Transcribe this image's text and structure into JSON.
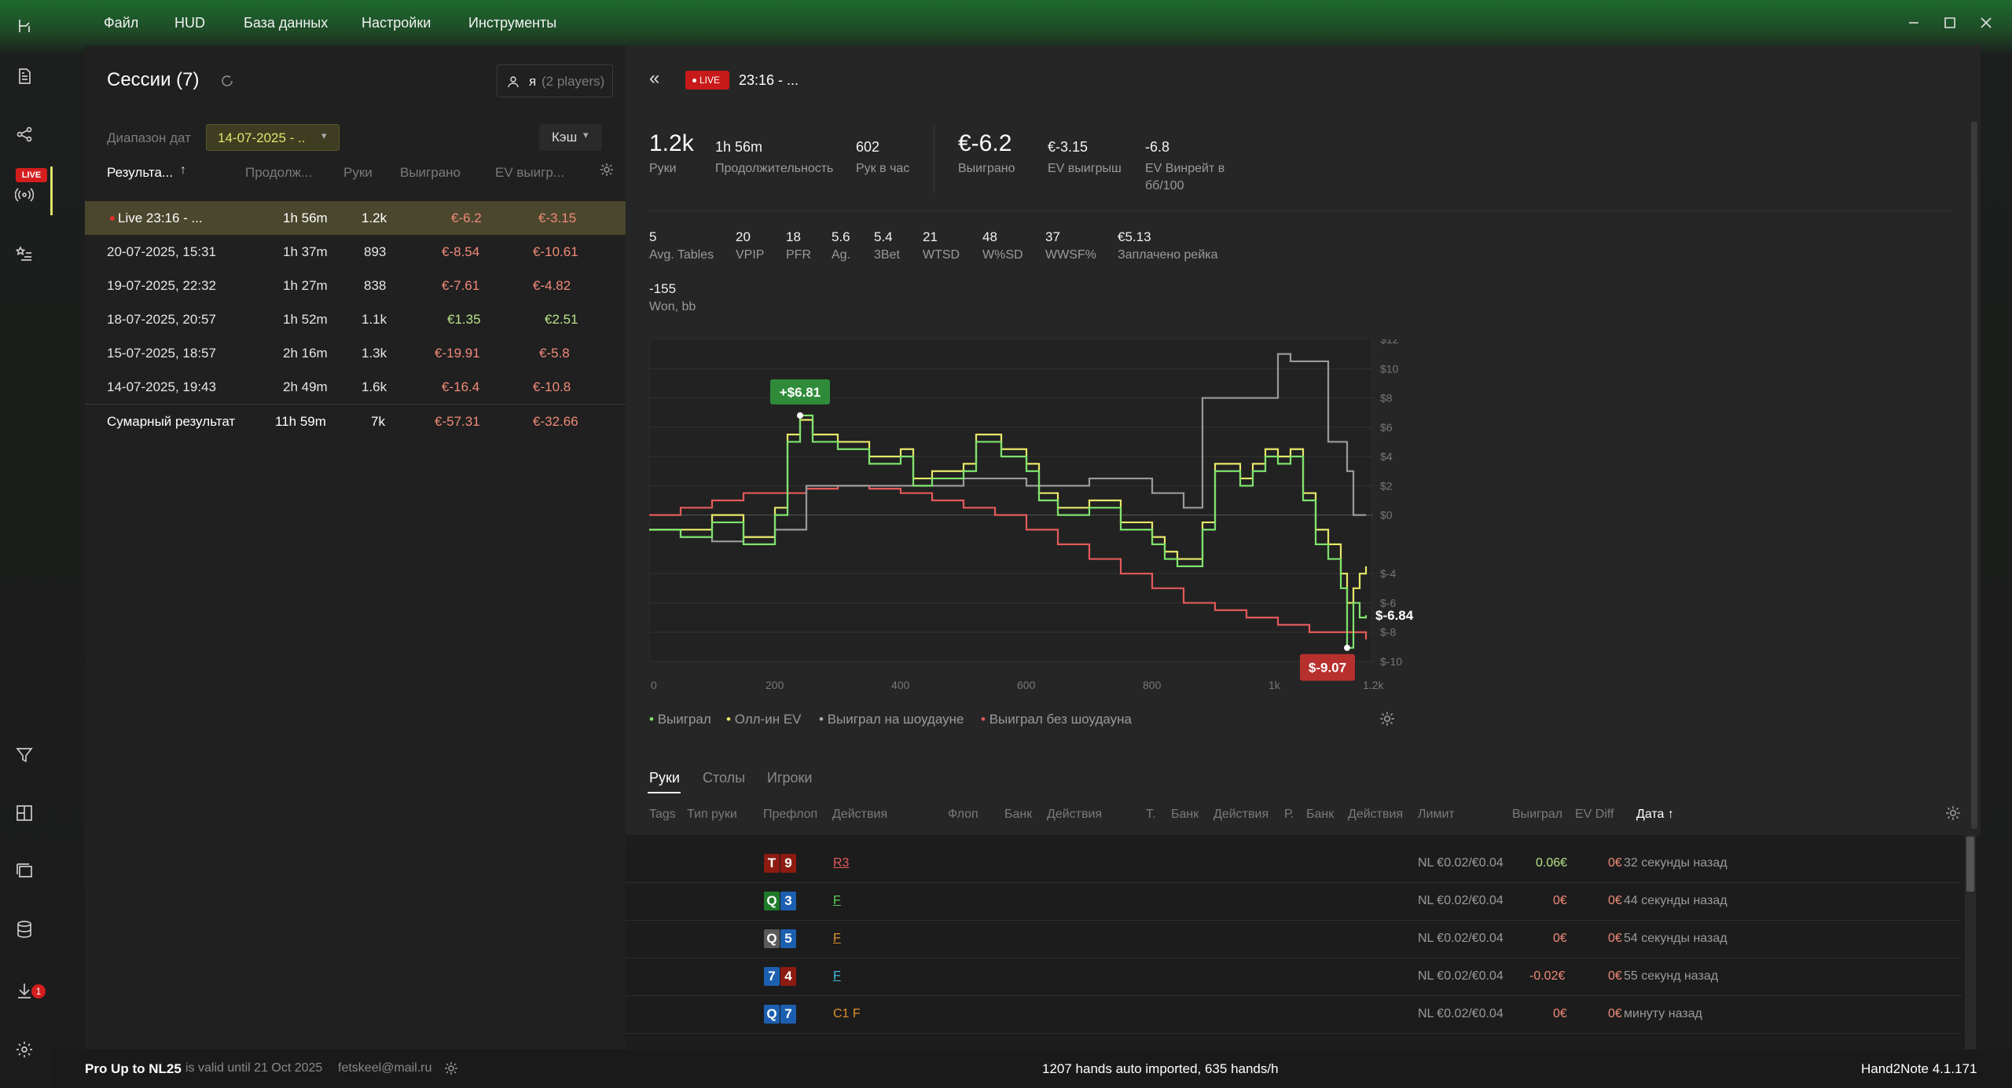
{
  "menu": {
    "file": "Файл",
    "hud": "HUD",
    "db": "База данных",
    "settings": "Настройки",
    "tools": "Инструменты"
  },
  "rail": {
    "live_badge": "LIVE",
    "update_count": "1"
  },
  "sessions": {
    "title": "Сессии (7)",
    "player_icon_label": "я",
    "player_count": "(2 players)",
    "date_range_label": "Диапазон дат",
    "date_range_value": "14-07-2025 - ..",
    "game_type": "Кэш",
    "columns": {
      "result": "Результа...",
      "duration": "Продолж...",
      "hands": "Руки",
      "won": "Выиграно",
      "ev": "EV выигр..."
    },
    "rows": [
      {
        "name": "Live 23:16 - ...",
        "duration": "1h 56m",
        "hands": "1.2k",
        "won": "€-6.2",
        "ev": "€-3.15"
      },
      {
        "name": "20-07-2025, 15:31",
        "duration": "1h 37m",
        "hands": "893",
        "won": "€-8.54",
        "ev": "€-10.61"
      },
      {
        "name": "19-07-2025, 22:32",
        "duration": "1h 27m",
        "hands": "838",
        "won": "€-7.61",
        "ev": "€-4.82"
      },
      {
        "name": "18-07-2025, 20:57",
        "duration": "1h 52m",
        "hands": "1.1k",
        "won": "€1.35",
        "ev": "€2.51"
      },
      {
        "name": "15-07-2025, 18:57",
        "duration": "2h 16m",
        "hands": "1.3k",
        "won": "€-19.91",
        "ev": "€-5.8"
      },
      {
        "name": "14-07-2025, 19:43",
        "duration": "2h 49m",
        "hands": "1.6k",
        "won": "€-16.4",
        "ev": "€-10.8"
      }
    ],
    "total": {
      "name": "Сумарный результат",
      "duration": "11h 59m",
      "hands": "7k",
      "won": "€-57.31",
      "ev": "€-32.66"
    }
  },
  "detail": {
    "live_badge": "LIVE",
    "session_title": "23:16 - ...",
    "stats1": [
      {
        "v": "1.2k",
        "l": "Руки"
      },
      {
        "v": "1h 56m",
        "l": "Продолжительность"
      },
      {
        "v": "602",
        "l": "Рук в час"
      },
      {
        "v": "€-6.2",
        "l": "Выиграно"
      },
      {
        "v": "€-3.15",
        "l": "EV выигрыш"
      },
      {
        "v": "-6.8",
        "l": "EV Винрейт в",
        "l2": "бб/100"
      }
    ],
    "stats2": [
      {
        "v": "5",
        "l": "Avg. Tables"
      },
      {
        "v": "20",
        "l": "VPIP"
      },
      {
        "v": "18",
        "l": "PFR"
      },
      {
        "v": "5.6",
        "l": "Ag."
      },
      {
        "v": "5.4",
        "l": "3Bet"
      },
      {
        "v": "21",
        "l": "WTSD"
      },
      {
        "v": "48",
        "l": "W%SD"
      },
      {
        "v": "37",
        "l": "WWSF%"
      },
      {
        "v": "€5.13",
        "l": "Заплачено рейка"
      }
    ],
    "stats3": {
      "v": "-155",
      "l": "Won, bb"
    }
  },
  "chart_data": {
    "type": "line",
    "x_ticks": [
      "0",
      "200",
      "400",
      "600",
      "800",
      "1k",
      "1.2k"
    ],
    "y_ticks": [
      "$12",
      "$10",
      "$8",
      "$6",
      "$4",
      "$2",
      "$0",
      "$-4",
      "$-6",
      "$-8",
      "$-10"
    ],
    "ylim": [
      -10,
      12
    ],
    "xlim": [
      0,
      1150
    ],
    "max_label": "+$6.81",
    "min_label": "$-9.07",
    "last_label": "$-6.84",
    "series": [
      {
        "name": "Выиграл",
        "color": "#7fe36d",
        "x": [
          0,
          50,
          100,
          150,
          200,
          220,
          240,
          260,
          300,
          350,
          400,
          420,
          450,
          500,
          520,
          560,
          600,
          620,
          650,
          700,
          750,
          800,
          820,
          840,
          880,
          900,
          940,
          960,
          980,
          1000,
          1020,
          1040,
          1060,
          1080,
          1100,
          1110,
          1120,
          1130,
          1140
        ],
        "y": [
          -1,
          -1.5,
          -0.5,
          -2,
          0,
          5,
          6.8,
          5,
          4.5,
          3.5,
          4,
          2,
          2.5,
          3,
          5,
          4,
          3,
          1,
          0,
          0.5,
          -1,
          -2,
          -3,
          -3.5,
          -1,
          3,
          2,
          3,
          4,
          3.5,
          4,
          1,
          -2,
          -3,
          -5,
          -9.07,
          -6,
          -7,
          -6.84
        ]
      },
      {
        "name": "Олл-ин EV",
        "color": "#e8e86a",
        "x": [
          0,
          50,
          100,
          150,
          200,
          220,
          240,
          260,
          300,
          350,
          400,
          420,
          450,
          500,
          520,
          560,
          600,
          620,
          650,
          700,
          750,
          800,
          820,
          840,
          880,
          900,
          940,
          960,
          980,
          1000,
          1020,
          1040,
          1060,
          1080,
          1100,
          1110,
          1120,
          1130,
          1140
        ],
        "y": [
          -1,
          -1,
          0,
          -1.5,
          0.5,
          5.5,
          6.5,
          5.5,
          5,
          4,
          4.5,
          2.5,
          3,
          3.5,
          5.5,
          4.5,
          3.5,
          1.5,
          0.5,
          1,
          -0.5,
          -1.5,
          -2.5,
          -3,
          -0.5,
          3.5,
          2.5,
          3.5,
          4.5,
          4,
          4.5,
          1.5,
          -1,
          -2,
          -4,
          -6,
          -5,
          -4,
          -3.5
        ]
      },
      {
        "name": "Выиграл на шоудауне",
        "color": "#9a9a9a",
        "x": [
          0,
          50,
          100,
          150,
          200,
          250,
          300,
          400,
          500,
          600,
          700,
          800,
          830,
          850,
          880,
          900,
          950,
          1000,
          1020,
          1050,
          1080,
          1100,
          1110,
          1120,
          1140
        ],
        "y": [
          -1,
          -1.5,
          -1.8,
          -1.5,
          -1,
          2,
          2,
          2,
          2.5,
          2,
          2.5,
          1.5,
          1.5,
          0.5,
          8,
          8,
          8,
          11,
          10.5,
          10.5,
          5,
          5,
          3,
          0,
          0
        ]
      },
      {
        "name": "Выиграл без шоудауна",
        "color": "#e35a5a",
        "x": [
          0,
          50,
          100,
          150,
          200,
          250,
          300,
          350,
          400,
          450,
          500,
          550,
          600,
          650,
          700,
          750,
          800,
          850,
          900,
          950,
          1000,
          1050,
          1100,
          1140
        ],
        "y": [
          0,
          0.5,
          1,
          1.5,
          1.5,
          1.8,
          2,
          1.8,
          1.5,
          1,
          0.5,
          0,
          -1,
          -2,
          -3,
          -4,
          -5,
          -6,
          -6.5,
          -7,
          -7.5,
          -8,
          -8,
          -8.5
        ]
      }
    ]
  },
  "legend": [
    "Выиграл",
    "Олл-ин EV",
    "Выиграл на шоудауне",
    "Выиграл без шоудауна"
  ],
  "tabs": [
    "Руки",
    "Столы",
    "Игроки"
  ],
  "hands_table": {
    "columns": [
      "Tags",
      "Тип руки",
      "Префлоп",
      "Действия",
      "Флоп",
      "Банк",
      "Действия",
      "Т.",
      "Банк",
      "Действия",
      "Р.",
      "Банк",
      "Действия",
      "Лимит",
      "Выиграл",
      "EV Diff",
      "Дата ↑"
    ],
    "rows": [
      {
        "c1": "T",
        "c1color": "#8c1b12",
        "c2": "9",
        "c2color": "#8c1b12",
        "action": "R3",
        "limit": "NL €0.02/€0.04",
        "won": "0.06€",
        "ev": "0€",
        "date": "32 секунды назад"
      },
      {
        "c1": "Q",
        "c1color": "#1f7a2a",
        "c2": "3",
        "c2color": "#1c5fb0",
        "action": "F",
        "limit": "NL €0.02/€0.04",
        "won": "0€",
        "ev": "0€",
        "date": "44 секунды назад"
      },
      {
        "c1": "Q",
        "c1color": "#5a5a5a",
        "c2": "5",
        "c2color": "#1c5fb0",
        "action": "F",
        "limit": "NL €0.02/€0.04",
        "won": "0€",
        "ev": "0€",
        "date": "54 секунды назад"
      },
      {
        "c1": "7",
        "c1color": "#1c5fb0",
        "c2": "4",
        "c2color": "#8c1b12",
        "action": "F",
        "limit": "NL €0.02/€0.04",
        "won": "-0.02€",
        "ev": "0€",
        "date": "55 секунд назад"
      },
      {
        "c1": "Q",
        "c1color": "#1c5fb0",
        "c2": "7",
        "c2color": "#1c5fb0",
        "action": "C1 F",
        "limit": "NL €0.02/€0.04",
        "won": "0€",
        "ev": "0€",
        "date": "минуту назад"
      }
    ]
  },
  "footer": {
    "license": "Pro Up to NL25",
    "valid": "is valid until 21 Oct 2025",
    "email": "fetskeel@mail.ru",
    "import_status": "1207 hands auto imported, 635 hands/h",
    "version": "Hand2Note 4.1.171"
  }
}
